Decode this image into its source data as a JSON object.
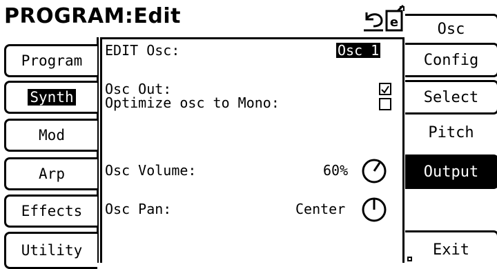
{
  "header": {
    "title": "PROGRAM:Edit"
  },
  "icons": {
    "undo": "undo-icon",
    "edit": "edit-doc-icon"
  },
  "left_tabs": [
    {
      "label": "Program",
      "active": false
    },
    {
      "label": "Synth",
      "active": true
    },
    {
      "label": "Mod",
      "active": false
    },
    {
      "label": "Arp",
      "active": false
    },
    {
      "label": "Effects",
      "active": false
    },
    {
      "label": "Utility",
      "active": false
    }
  ],
  "right_tabs": [
    {
      "label": "Osc",
      "active": false
    },
    {
      "label": "Config",
      "active": false
    },
    {
      "label": "Select",
      "active": false
    },
    {
      "label": "Pitch",
      "active": false
    },
    {
      "label": "Output",
      "active": true
    },
    {
      "label": "Exit",
      "active": false
    }
  ],
  "main": {
    "edit_label": "EDIT Osc:",
    "edit_value": "Osc 1",
    "osc_out_label": "Osc Out:",
    "osc_out_checked": true,
    "optimize_label": "Optimize osc to Mono:",
    "optimize_checked": false,
    "volume_label": "Osc Volume:",
    "volume_value": "60%",
    "pan_label": "Osc Pan:",
    "pan_value": "Center"
  }
}
